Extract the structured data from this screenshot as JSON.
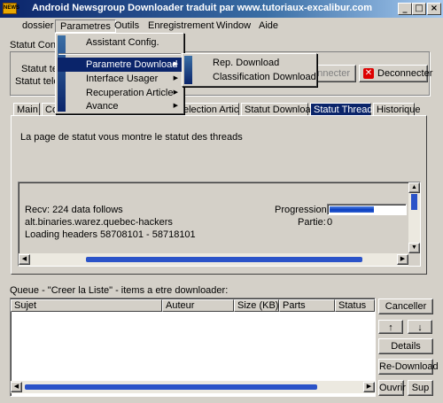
{
  "window": {
    "title": "Android Newsgroup Downloader traduit par www.tutoriaux-excalibur.com",
    "icon_label": "NEWS",
    "minimize": "_",
    "maximize": "□",
    "close": "×"
  },
  "menu": {
    "dossier": "dossier",
    "parametres": "Parametres",
    "outils": "Outils",
    "enregistrement": "Enregistrement",
    "window": "Window",
    "aide": "Aide"
  },
  "parametres_menu": {
    "assistant": "Assistant Config.",
    "download": "Parametre Download",
    "interface": "Interface Usager",
    "recuperation": "Recuperation Article",
    "avance": "Avance"
  },
  "download_submenu": {
    "rep": "Rep. Download",
    "classification": "Classification Download"
  },
  "connection": {
    "group_label": "Statut Conne",
    "statut1": "Statut tele",
    "statut2": "Statut tele",
    "connect_label": "nnecter",
    "disconnect_label": "Deconnecter"
  },
  "tabs": [
    "Main",
    "Co",
    "election Article",
    "Statut Download",
    "Statut Threads",
    "Historique"
  ],
  "panel": {
    "description": "La page de statut vous montre le statut des threads",
    "recv": "Recv: 224 data follows",
    "group": "alt.binaries.warez.quebec-hackers",
    "loading": "Loading headers 58708101 - 58718101",
    "progression_label": "Progression:",
    "partie_label": "Partie:",
    "partie_value": "0",
    "progress_value": 0.6
  },
  "queue": {
    "title": "Queue - \"Creer la Liste\" - items a etre downloader:",
    "columns": [
      "Sujet",
      "Auteur",
      "Size (KB)",
      "Parts",
      "Status"
    ]
  },
  "buttons": {
    "canceller": "Canceller",
    "up": "↑",
    "down": "↓",
    "details": "Details",
    "redownload": "Re-Download",
    "ouvrir": "Ouvrir",
    "sup": "Sup"
  },
  "colors": {
    "title_bar": "#0a246a",
    "highlight": "#0a246a",
    "progress": "#0a3ec0",
    "face": "#d4d0c8"
  }
}
